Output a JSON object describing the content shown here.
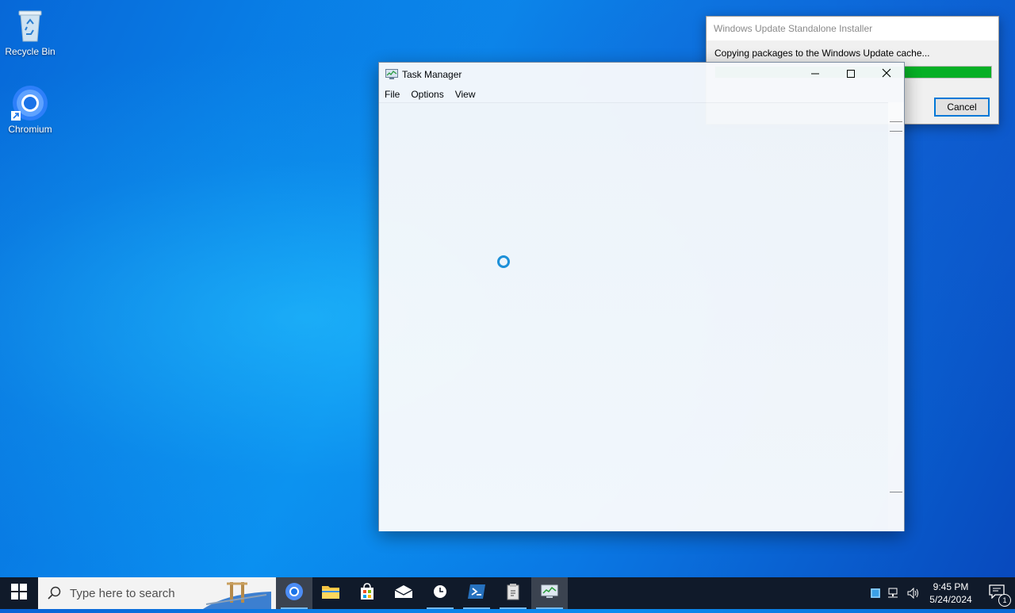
{
  "desktop": {
    "icons": [
      {
        "label": "Recycle Bin",
        "icon": "recycle-bin-icon"
      },
      {
        "label": "Chromium",
        "icon": "chromium-icon"
      }
    ]
  },
  "update_installer": {
    "title": "Windows Update Standalone Installer",
    "message": "Copying packages to the Windows Update cache...",
    "progress": 1.0,
    "progress_color": "#06b025",
    "cancel_label": "Cancel"
  },
  "task_manager": {
    "title": "Task Manager",
    "menu": [
      "File",
      "Options",
      "View"
    ]
  },
  "taskbar": {
    "search_placeholder": "Type here to search",
    "apps": [
      "chromium",
      "file-explorer",
      "microsoft-store",
      "mail",
      "clock",
      "powershell",
      "update-installer",
      "task-manager"
    ],
    "time": "9:45 PM",
    "date": "5/24/2024",
    "notification_count": "1"
  }
}
